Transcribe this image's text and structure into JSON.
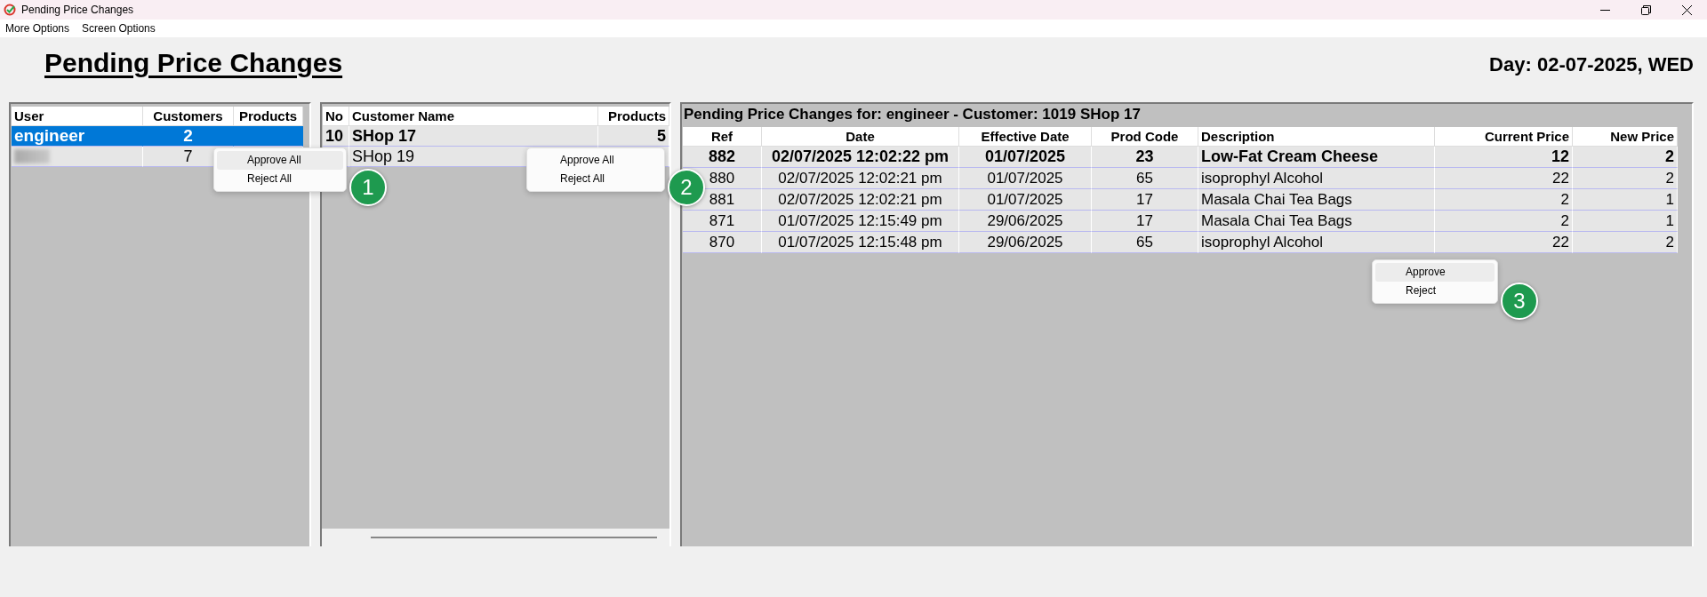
{
  "window": {
    "title": "Pending Price Changes"
  },
  "menu_bar": [
    "More Options",
    "Screen Options"
  ],
  "heading": "Pending Price Changes",
  "day": "Day: 02-07-2025, WED",
  "users_table": {
    "columns": [
      "User",
      "Customers",
      "Products"
    ],
    "rows": [
      {
        "user": "engineer",
        "customers": "2",
        "selected": true,
        "blurred": false
      },
      {
        "customers": "7",
        "selected": false,
        "blurred": true
      }
    ]
  },
  "customers_table": {
    "columns": [
      "No",
      "Customer Name",
      "Products"
    ],
    "rows": [
      {
        "no": "10",
        "name": "SHop 17",
        "products": "5",
        "selected": true
      },
      {
        "name": "SHop 19",
        "selected": false
      }
    ]
  },
  "changes": {
    "title": "Pending Price Changes for: engineer - Customer: 1019 SHop 17",
    "columns": [
      "Ref",
      "Date",
      "Effective Date",
      "Prod Code",
      "Description",
      "Current Price",
      "New Price"
    ],
    "rows": [
      {
        "ref": "882",
        "date": "02/07/2025 12:02:22 pm",
        "effective_date": "01/07/2025",
        "prod_code": "23",
        "description": "Low-Fat Cream Cheese",
        "current_price": "12",
        "new_price": "2",
        "selected": true
      },
      {
        "ref": "880",
        "date": "02/07/2025 12:02:21 pm",
        "effective_date": "01/07/2025",
        "prod_code": "65",
        "description": "isoprophyl Alcohol",
        "current_price": "22",
        "new_price": "2",
        "selected": false
      },
      {
        "ref": "881",
        "date": "02/07/2025 12:02:21 pm",
        "effective_date": "01/07/2025",
        "prod_code": "17",
        "description": "Masala Chai Tea Bags",
        "current_price": "2",
        "new_price": "1",
        "selected": false
      },
      {
        "ref": "871",
        "date": "01/07/2025 12:15:49 pm",
        "effective_date": "29/06/2025",
        "prod_code": "17",
        "description": "Masala Chai Tea Bags",
        "current_price": "2",
        "new_price": "1",
        "selected": false
      },
      {
        "ref": "870",
        "date": "01/07/2025 12:15:48 pm",
        "effective_date": "29/06/2025",
        "prod_code": "65",
        "description": "isoprophyl Alcohol",
        "current_price": "22",
        "new_price": "2",
        "selected": false
      }
    ]
  },
  "context_menus": [
    {
      "badge": "1",
      "items": [
        {
          "label": "Approve All",
          "highlighted": true
        },
        {
          "label": "Reject All",
          "highlighted": false
        }
      ]
    },
    {
      "badge": "2",
      "items": [
        {
          "label": "Approve All",
          "highlighted": false
        },
        {
          "label": "Reject All",
          "highlighted": false
        }
      ]
    },
    {
      "badge": "3",
      "items": [
        {
          "label": "Approve",
          "highlighted": true
        },
        {
          "label": "Reject",
          "highlighted": false
        }
      ]
    }
  ]
}
